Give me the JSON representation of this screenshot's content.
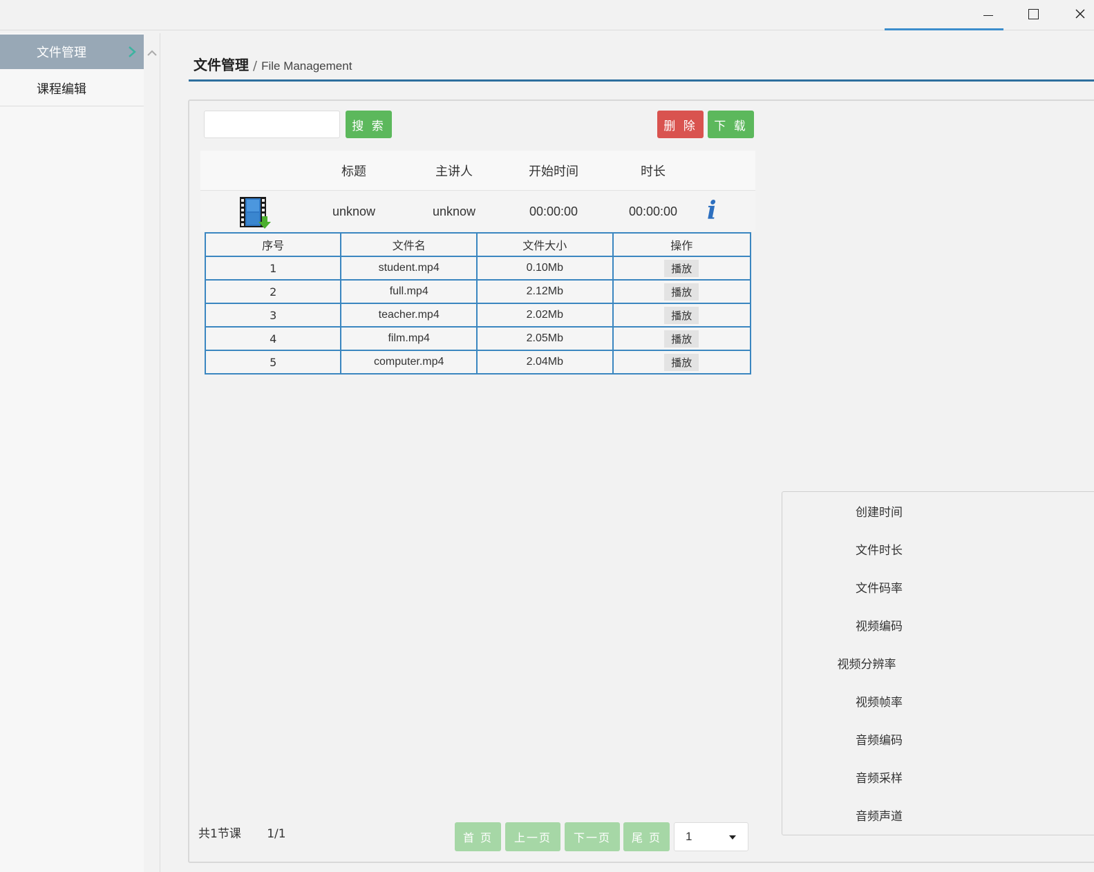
{
  "window": {
    "controls": {
      "minimize": "minimize-icon",
      "maximize": "maximize-icon",
      "close": "close-icon"
    }
  },
  "sidebar": {
    "items": [
      {
        "label": "文件管理",
        "active": true,
        "icon": "chevron-right-icon"
      },
      {
        "label": "课程编辑",
        "active": false
      }
    ],
    "scroll_icon": "chevron-up-icon"
  },
  "breadcrumb": {
    "main": "文件管理",
    "separator": "/",
    "sub": "File Management"
  },
  "toolbar": {
    "search_value": "",
    "search_label": "搜 索",
    "delete_label": "删 除",
    "download_label": "下 载"
  },
  "course_table": {
    "headers": [
      "标题",
      "主讲人",
      "开始时间",
      "时长"
    ],
    "row": {
      "icon": "video-file-icon",
      "title": "unknow",
      "lecturer": "unknow",
      "start_time": "00:00:00",
      "duration": "00:00:00",
      "info_icon": "i"
    }
  },
  "file_table": {
    "headers": [
      "序号",
      "文件名",
      "文件大小",
      "操作"
    ],
    "rows": [
      {
        "index": "1",
        "name": "student.mp4",
        "size": "0.10Mb",
        "action": "播放"
      },
      {
        "index": "2",
        "name": "full.mp4",
        "size": "2.12Mb",
        "action": "播放"
      },
      {
        "index": "3",
        "name": "teacher.mp4",
        "size": "2.02Mb",
        "action": "播放"
      },
      {
        "index": "4",
        "name": "film.mp4",
        "size": "2.05Mb",
        "action": "播放"
      },
      {
        "index": "5",
        "name": "computer.mp4",
        "size": "2.04Mb",
        "action": "播放"
      }
    ]
  },
  "properties": {
    "labels": [
      "创建时间",
      "文件时长",
      "文件码率",
      "视频编码",
      "视频分辨率",
      "视频帧率",
      "音频编码",
      "音频采样",
      "音频声道"
    ]
  },
  "pager": {
    "total": "共1节课",
    "page_info": "1/1",
    "first": "首 页",
    "prev": "上一页",
    "next": "下一页",
    "last": "尾 页",
    "selected_page": "1"
  },
  "colors": {
    "accent_blue": "#2e6f9e",
    "green": "#5cb85c",
    "red": "#d9534f",
    "table_border": "#3a86c0",
    "sidebar_active": "#98a8b6"
  }
}
